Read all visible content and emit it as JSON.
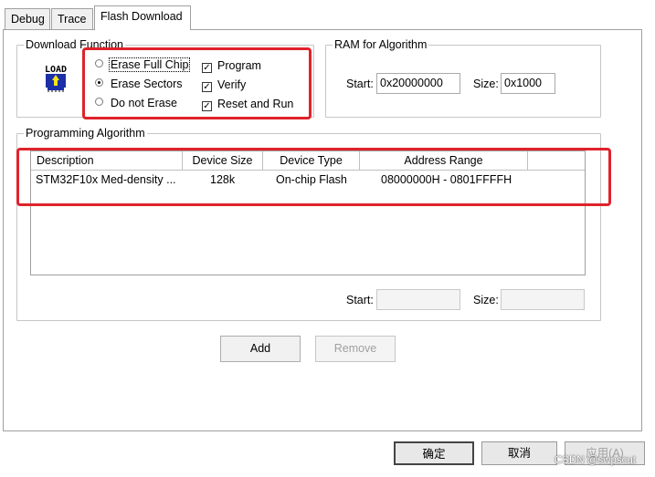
{
  "tabs": [
    {
      "label": "Debug"
    },
    {
      "label": "Trace"
    },
    {
      "label": "Flash Download"
    }
  ],
  "download_function": {
    "title": "Download Function",
    "load_icon_text": "LOAD",
    "erase_options": [
      {
        "label": "Erase Full Chip",
        "selected": false
      },
      {
        "label": "Erase Sectors",
        "selected": true
      },
      {
        "label": "Do not Erase",
        "selected": false
      }
    ],
    "checks": [
      {
        "label": "Program",
        "checked": true
      },
      {
        "label": "Verify",
        "checked": true
      },
      {
        "label": "Reset and Run",
        "checked": true
      }
    ]
  },
  "ram": {
    "title": "RAM for Algorithm",
    "start_label": "Start:",
    "start_value": "0x20000000",
    "size_label": "Size:",
    "size_value": "0x1000"
  },
  "programming": {
    "title": "Programming Algorithm",
    "columns": [
      "Description",
      "Device Size",
      "Device Type",
      "Address Range"
    ],
    "rows": [
      {
        "description": "STM32F10x Med-density ...",
        "size": "128k",
        "type": "On-chip Flash",
        "range": "08000000H - 0801FFFFH"
      }
    ],
    "start_label": "Start:",
    "start_value": "",
    "size_label": "Size:",
    "size_value": ""
  },
  "buttons": {
    "add": "Add",
    "remove": "Remove"
  },
  "dialog_buttons": {
    "ok": "确定",
    "cancel": "取消",
    "apply": "应用(A)"
  },
  "watermark": "CSDN @swpscut",
  "colors": {
    "annotation": "#e0222b",
    "border": "#a0a0a0"
  }
}
